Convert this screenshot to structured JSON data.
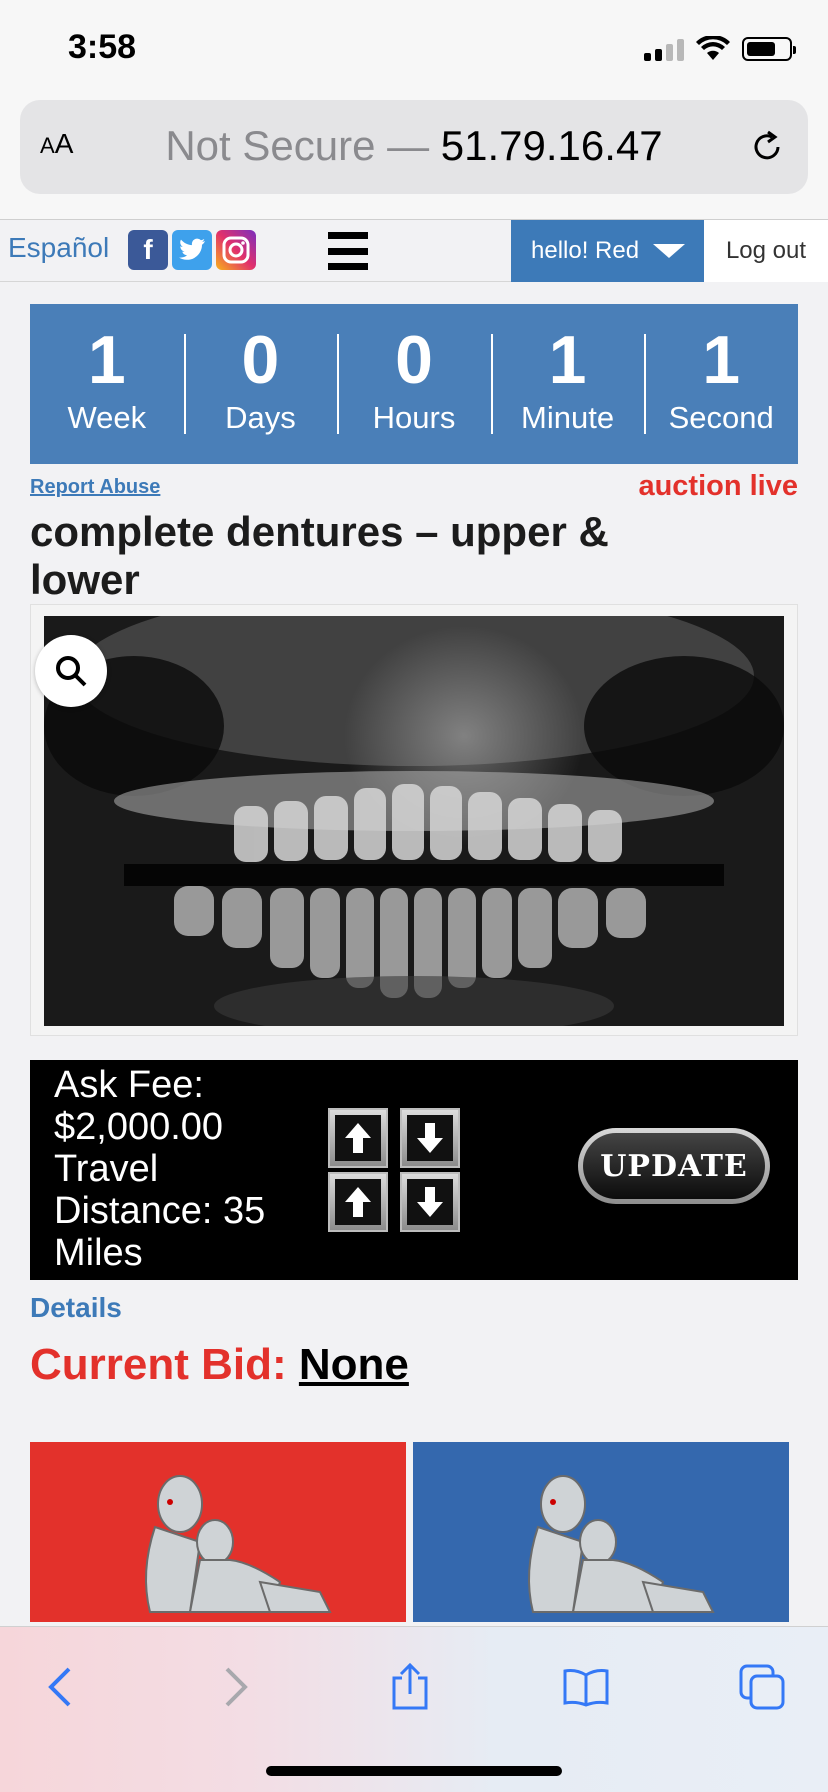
{
  "status_bar": {
    "time": "3:58"
  },
  "browser": {
    "aa_label_small": "A",
    "aa_label_large": "A",
    "security": "Not Secure —",
    "host": "51.79.16.47"
  },
  "header": {
    "language": "Español",
    "social": [
      "f",
      "twitter",
      "instagram"
    ],
    "greeting": "hello! Red",
    "logout": "Log out",
    "accent_color": "#3d7ab8"
  },
  "countdown": [
    {
      "value": "1",
      "label": "Week"
    },
    {
      "value": "0",
      "label": "Days"
    },
    {
      "value": "0",
      "label": "Hours"
    },
    {
      "value": "1",
      "label": "Minute"
    },
    {
      "value": "1",
      "label": "Second"
    }
  ],
  "listing": {
    "report_abuse": "Report Abuse",
    "status": "auction live",
    "title": "complete dentures – upper & lower",
    "image_icon": "xray-image",
    "ask_panel": {
      "text": "Ask Fee: $2,000.00 Travel Distance: 35 Miles",
      "update_label": "UPDATE"
    },
    "details_link": "Details",
    "current_bid_label": "Current Bid:",
    "current_bid_value": "None"
  },
  "promo_tiles": [
    {
      "color": "#e3312b",
      "icon": "dental-chair-icon"
    },
    {
      "color": "#3468ae",
      "icon": "dental-chair-icon"
    }
  ],
  "toolbar": [
    "back-icon",
    "forward-icon",
    "share-icon",
    "bookmarks-icon",
    "tabs-icon"
  ]
}
